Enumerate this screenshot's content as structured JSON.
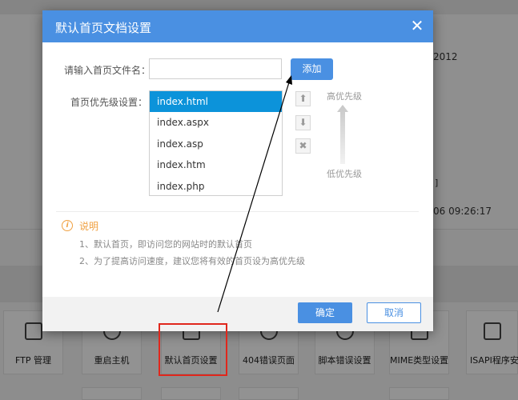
{
  "dialog": {
    "title": "默认首页文档设置",
    "close_glyph": "✕",
    "name_label": "请输入首页文件名：",
    "name_value": "",
    "add_button": "添加",
    "priority_label": "首页优先级设置：",
    "index_files": [
      "index.html",
      "index.aspx",
      "index.asp",
      "index.htm",
      "index.php"
    ],
    "selected_index": 0,
    "move_up_glyph": "⬆",
    "move_down_glyph": "⬇",
    "remove_glyph": "✖",
    "priority_high": "高优先级",
    "priority_low": "低优先级",
    "note_icon_glyph": "i",
    "note_title": "说明",
    "note_lines": [
      "1、默认首页，即访问您的网站时的默认首页",
      "2、为了提高访问速度，建议您将有效的首页设为高优先级"
    ],
    "ok_button": "确定",
    "cancel_button": "取消"
  },
  "background": {
    "date_fragment": "2012",
    "bracket_fragment": "]",
    "datetime_fragment": "06 09:26:17",
    "tiles": [
      {
        "label": "FTP 管理",
        "icon": "ftp-icon"
      },
      {
        "label": "重启主机",
        "icon": "restart-icon"
      },
      {
        "label": "默认首页设置",
        "icon": "default-page-icon"
      },
      {
        "label": "404错误页面",
        "icon": "error-404-icon"
      },
      {
        "label": "脚本错误设置",
        "icon": "script-error-icon"
      },
      {
        "label": "MIME类型设置",
        "icon": "mime-icon"
      },
      {
        "label": "ISAPI程序安",
        "icon": "isapi-icon"
      }
    ]
  },
  "annotation": {
    "highlight_color": "#e0271c",
    "arrow_color": "#000000"
  }
}
